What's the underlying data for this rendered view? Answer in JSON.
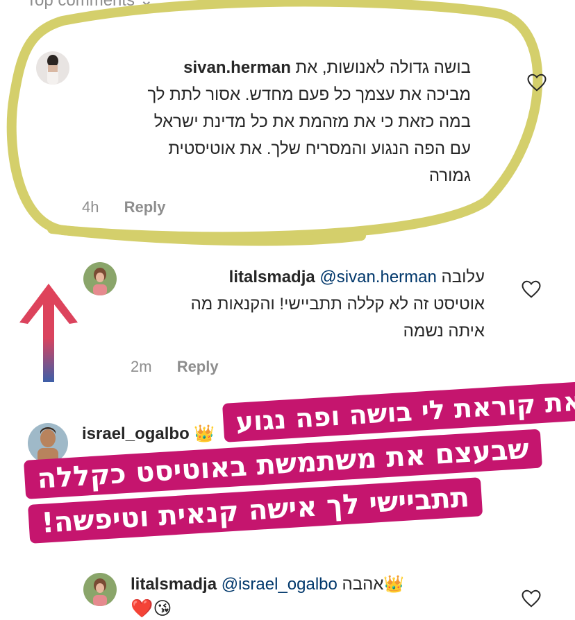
{
  "header": {
    "label": "Top comments"
  },
  "comments": [
    {
      "username": "sivan.herman",
      "lines": [
        "בושה גדולה לאנושות, את",
        "מביכה את עצמך כל פעם מחדש. אסור לתת לך",
        "במה כזאת כי את מזהמת את כל מדינת ישראל",
        "עם הפה הנגוע והמסריח שלך. את אוטיסטית",
        "גמורה"
      ],
      "time": "4h",
      "reply": "Reply"
    },
    {
      "username": "litalsmadja",
      "mention": "@sivan.herman",
      "text_after_mention": "עלובה",
      "lines": [
        "אוטיסט זה לא קללה תתביישי! והקנאות מה",
        "איתה נשמה"
      ],
      "time": "2m",
      "reply": "Reply"
    },
    {
      "username": "israel_ogalbo",
      "badge": "👑"
    },
    {
      "username": "litalsmadja",
      "mention": "@israel_ogalbo",
      "text_after_mention": "אהבה",
      "badge": "👑",
      "emojis": "❤️😘"
    }
  ],
  "overlay": {
    "lines": [
      "סיון יקירה את קוראת לי בושה ופה נגוע",
      "שבעצם את משתמשת באוטיסט כקללה",
      "תתביישי לך אישה קנאית וטיפשה!"
    ]
  },
  "colors": {
    "highlight_circle": "#d4cf6b",
    "banner": "#c5156e",
    "arrow_top": "#e0435a",
    "arrow_bottom": "#3d5fa8"
  }
}
